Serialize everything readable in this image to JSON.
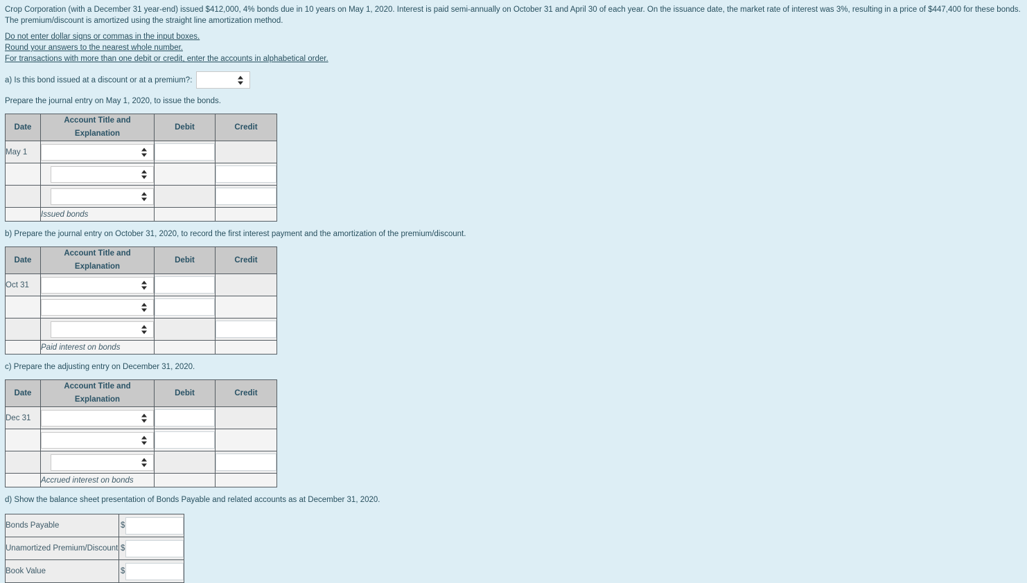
{
  "problem": {
    "intro": "Crop Corporation (with a December 31 year-end) issued $412,000, 4% bonds due in 10 years on May 1, 2020. Interest is paid semi-annually on October 31 and April 30 of each year. On the issuance date, the market rate of interest was 3%, resulting in a price of $447,400 for these bonds. The premium/discount is amortized using the straight line amortization method.",
    "rules": [
      "Do not enter dollar signs or commas in the input boxes.",
      "Round your answers to the nearest whole number.",
      "For transactions with more than one debit or credit, enter the accounts in alphabetical order."
    ]
  },
  "part_a": {
    "question": "a) Is this bond issued at a discount or at a premium?:",
    "select_value": "",
    "instruction": "Prepare the journal entry on May 1, 2020, to issue the bonds.",
    "table": {
      "headers": [
        "Date",
        "Account Title and Explanation",
        "Debit",
        "Credit"
      ],
      "rows": [
        {
          "date": "May 1",
          "account": "",
          "indent": false,
          "debit": true,
          "credit": false
        },
        {
          "date": "",
          "account": "",
          "indent": true,
          "debit": false,
          "credit": true
        },
        {
          "date": "",
          "account": "",
          "indent": true,
          "debit": false,
          "credit": true
        }
      ],
      "explanation": "Issued bonds"
    }
  },
  "part_b": {
    "question": "b) Prepare the journal entry on October 31, 2020, to record the first interest payment and the amortization of the premium/discount.",
    "table": {
      "headers": [
        "Date",
        "Account Title and Explanation",
        "Debit",
        "Credit"
      ],
      "rows": [
        {
          "date": "Oct 31",
          "account": "",
          "indent": false,
          "debit": true,
          "credit": false
        },
        {
          "date": "",
          "account": "",
          "indent": false,
          "debit": true,
          "credit": false
        },
        {
          "date": "",
          "account": "",
          "indent": true,
          "debit": false,
          "credit": true
        }
      ],
      "explanation": "Paid interest on bonds"
    }
  },
  "part_c": {
    "question": "c) Prepare the adjusting entry on December 31, 2020.",
    "table": {
      "headers": [
        "Date",
        "Account Title and Explanation",
        "Debit",
        "Credit"
      ],
      "rows": [
        {
          "date": "Dec 31",
          "account": "",
          "indent": false,
          "debit": true,
          "credit": false
        },
        {
          "date": "",
          "account": "",
          "indent": false,
          "debit": true,
          "credit": false
        },
        {
          "date": "",
          "account": "",
          "indent": true,
          "debit": false,
          "credit": true
        }
      ],
      "explanation": "Accrued interest on bonds"
    }
  },
  "part_d": {
    "question": "d) Show the balance sheet presentation of Bonds Payable and related accounts as at December 31, 2020.",
    "rows": [
      {
        "label": "Bonds Payable",
        "currency": "$",
        "value": ""
      },
      {
        "label": "Unamortized Premium/Discount",
        "currency": "$",
        "value": ""
      },
      {
        "label": "Book Value",
        "currency": "$",
        "value": ""
      }
    ]
  },
  "colors": {
    "page_background": "#ddeef5",
    "header_background": "#c9c9c9",
    "row_background": "#ededed",
    "row_alt_background": "#f4f4f4",
    "text": "#28505f",
    "border": "#555d63"
  }
}
